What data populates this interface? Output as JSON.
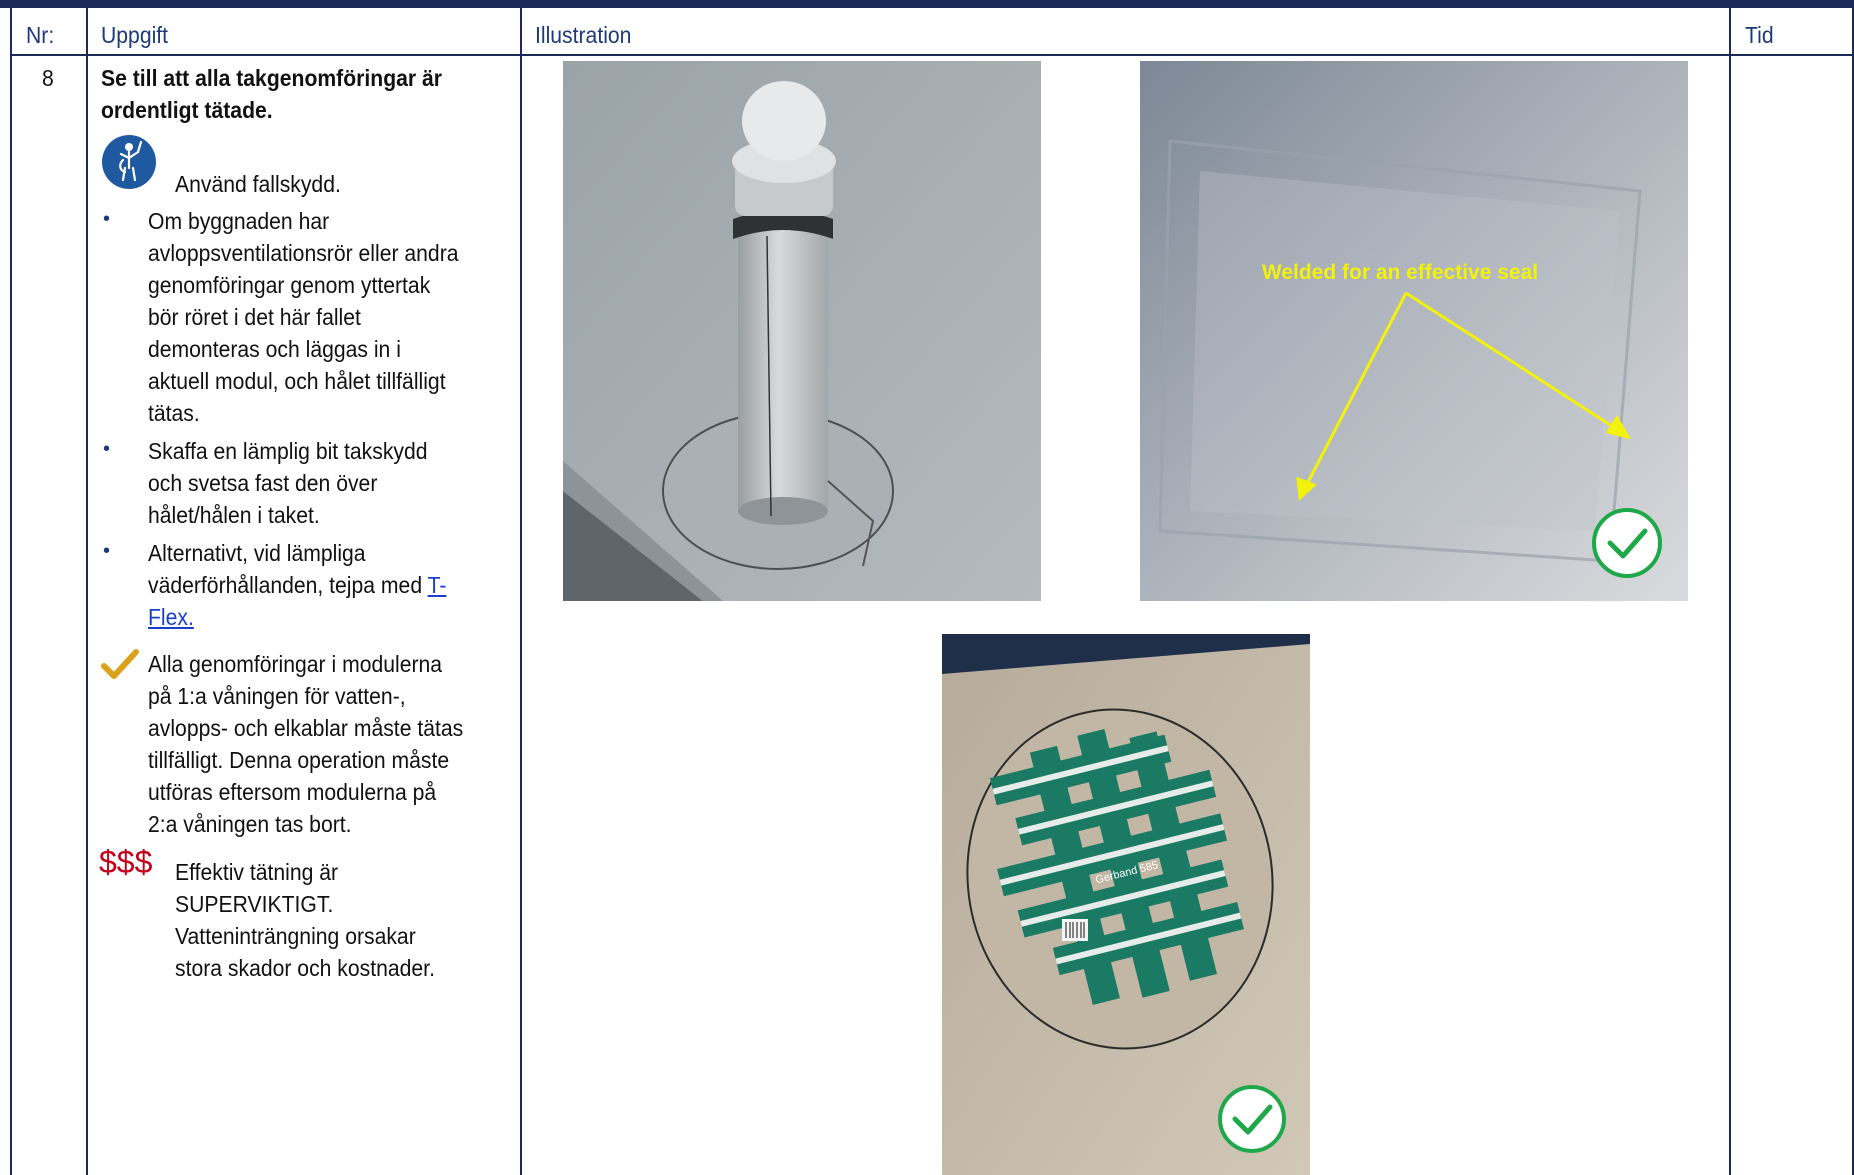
{
  "header": {
    "nr": "Nr:",
    "uppgift": "Uppgift",
    "illustration": "Illustration",
    "tid": "Tid"
  },
  "row": {
    "nr": "8",
    "title_line1": "Se till att alla takgenomföringar är",
    "title_line2": "ordentligt tätade.",
    "fall_protection": "Använd fallskydd.",
    "bullet1": [
      "Om byggnaden har",
      "avloppsventilationsrör eller andra",
      "genomföringar genom yttertak",
      "bör röret i det här fallet",
      "demonteras och läggas in i",
      "aktuell modul, och hålet tillfälligt",
      "tätas."
    ],
    "bullet2": [
      "Skaffa en lämplig bit takskydd",
      "och svetsa fast den över",
      "hålet/hålen i taket."
    ],
    "bullet3_line1": "Alternativt, vid lämpliga",
    "bullet3_line2_prefix": "väderförhållanden, tejpa med ",
    "bullet3_link_part1": "T-",
    "bullet3_link_part2": "Flex.",
    "check_note": [
      "Alla genomföringar i modulerna",
      "på 1:a våningen för vatten-,",
      "avlopps- och elkablar måste tätas",
      "tillfälligt. Denna operation måste",
      "utföras eftersom modulerna på",
      "2:a våningen tas bort."
    ],
    "cost_symbol": "$$$",
    "cost_note": [
      "Effektiv tätning är",
      "SUPERVIKTIGT.",
      "Vatteninträngning orsakar",
      "stora skador och kostnader."
    ]
  },
  "illustration": {
    "photo2_caption": "Welded for an effective seal",
    "tape_brand": "Gerband 585"
  },
  "colors": {
    "frame": "#1c2a5a",
    "header_text": "#1c3a7a",
    "caption": "#f2f20a",
    "check_green": "#1fa84a",
    "cost_red": "#c4001a",
    "tape_green": "#1b7a64"
  },
  "icons": [
    "fall-protection-icon",
    "checkmark-icon",
    "green-check-icon"
  ]
}
